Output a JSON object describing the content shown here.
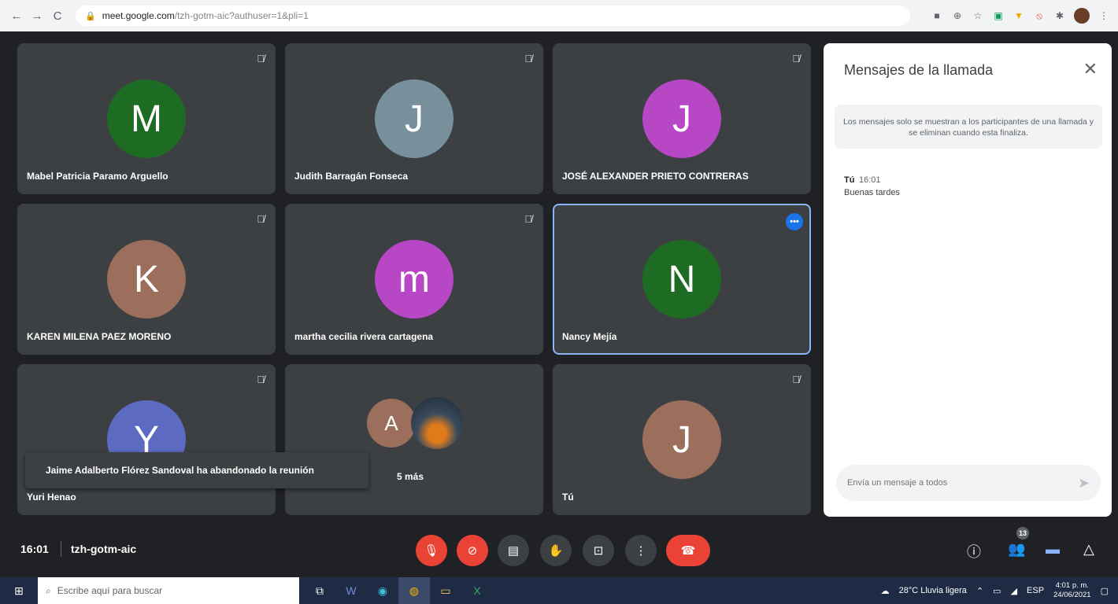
{
  "browser": {
    "url_host": "meet.google.com",
    "url_path": "/tzh-gotm-aic?authuser=1&pli=1",
    "nav_back": "←",
    "nav_forward": "→",
    "nav_reload": "C"
  },
  "tiles": [
    {
      "initial": "M",
      "name": "Mabel Patricia Paramo Arguello",
      "color": "#1e6b24"
    },
    {
      "initial": "J",
      "name": "Judith Barragán Fonseca",
      "color": "#78909c"
    },
    {
      "initial": "J",
      "name": "JOSÉ ALEXANDER PRIETO CONTRERAS",
      "color": "#b847c6"
    },
    {
      "initial": "K",
      "name": "KAREN MILENA PAEZ MORENO",
      "color": "#9b6f5c"
    },
    {
      "initial": "m",
      "name": "martha cecilia rivera cartagena",
      "color": "#b847c6"
    },
    {
      "initial": "N",
      "name": "Nancy Mejía",
      "color": "#1e6b24"
    },
    {
      "initial": "Y",
      "name": "Yuri Henao",
      "color": "#5c6bc0"
    },
    {
      "initial": "A",
      "more": "5 más",
      "color": "#9b6f5c"
    },
    {
      "initial": "J",
      "name": "Tú",
      "color": "#9b6f5c"
    }
  ],
  "toast": "Jaime Adalberto Flórez Sandoval ha abandonado la reunión",
  "chat": {
    "title": "Mensajes de la llamada",
    "notice": "Los mensajes solo se muestran a los participantes de una llamada y se eliminan cuando esta finaliza.",
    "message": {
      "sender": "Tú",
      "time": "16:01",
      "text": "Buenas tardes"
    },
    "input_placeholder": "Envía un mensaje a todos"
  },
  "meeting": {
    "time": "16:01",
    "code": "tzh-gotm-aic",
    "participants_count": "13"
  },
  "taskbar": {
    "search_placeholder": "Escribe aquí para buscar",
    "weather": "28°C Lluvia ligera",
    "lang": "ESP",
    "time": "4:01 p. m.",
    "date": "24/06/2021"
  }
}
